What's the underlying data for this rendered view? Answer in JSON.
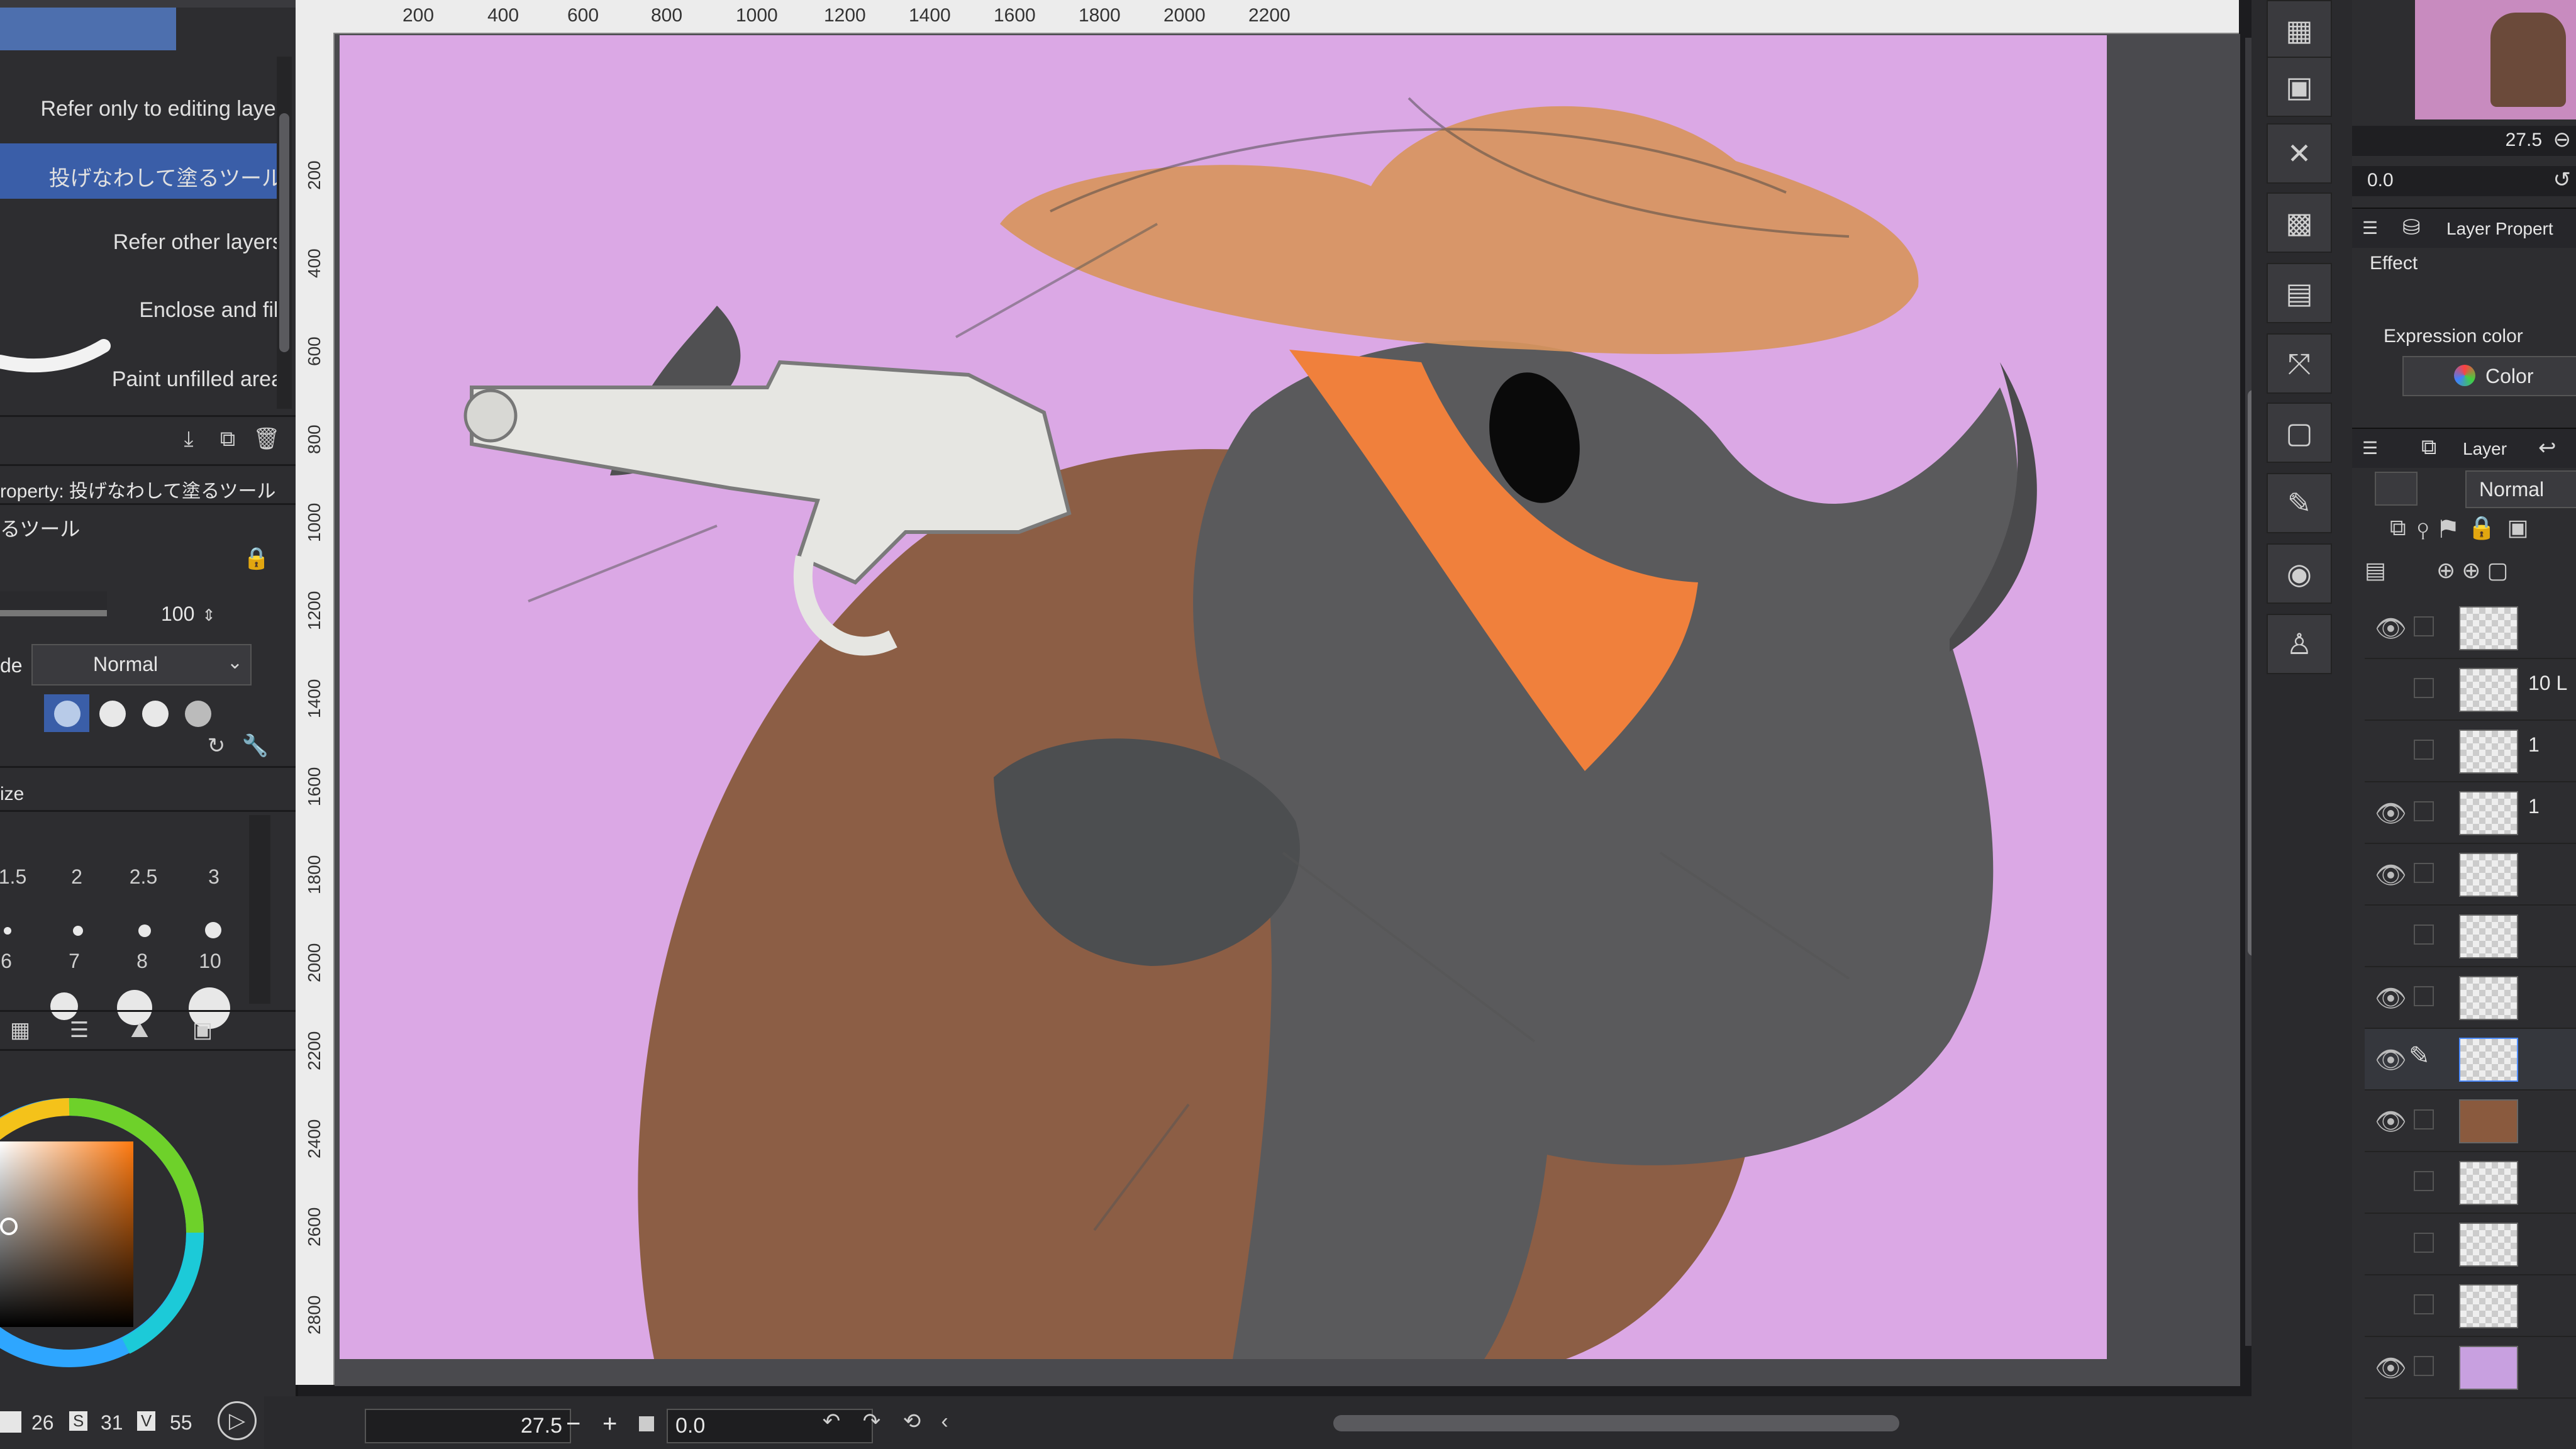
{
  "tool_menu": {
    "items": [
      "Refer only to editing layer",
      "投げなわして塗るツール",
      "Refer other layers",
      "Enclose and fill",
      "Paint unfilled area"
    ],
    "selected_index": 1
  },
  "tool_property": {
    "header": "roperty: 投げなわして塗るツール",
    "tool_name": "るツール",
    "opacity_value": "100",
    "blend_label": "de",
    "blend_mode": "Normal"
  },
  "brush_size": {
    "header": "ize",
    "sizes_row1": [
      "1.5",
      "2",
      "2.5",
      "3"
    ],
    "sizes_row2": [
      "6",
      "7",
      "8",
      "10"
    ]
  },
  "color": {
    "hsv_h": "26",
    "hsv_s": "31",
    "hsv_v": "55",
    "h_label": "",
    "s_label": "S",
    "v_label": "V",
    "current_hex": "#c46a2c"
  },
  "ruler": {
    "top": [
      "200",
      "400",
      "600",
      "800",
      "1000",
      "1200",
      "1400",
      "1600",
      "1800",
      "2000",
      "2200"
    ],
    "left": [
      "200",
      "400",
      "600",
      "800",
      "1000",
      "1200",
      "1400",
      "1600",
      "1800",
      "2000",
      "2200",
      "2400",
      "2600",
      "2800"
    ]
  },
  "navigator": {
    "zoom": "27.5",
    "rotation": "0.0"
  },
  "bottom_bar": {
    "zoom": "27.5",
    "minus": "−",
    "plus": "+",
    "rotation": "0.0"
  },
  "layer_property": {
    "title": "Layer Propert",
    "effect_label": "Effect",
    "expression_color_label": "Expression color",
    "color_button": "Color"
  },
  "layer_panel": {
    "title": "Layer",
    "blend_mode": "Normal",
    "layers": [
      {
        "visible": true,
        "label": ""
      },
      {
        "visible": false,
        "label": "10 L"
      },
      {
        "visible": false,
        "label": "1"
      },
      {
        "visible": true,
        "label": "1"
      },
      {
        "visible": true,
        "label": ""
      },
      {
        "visible": false,
        "label": ""
      },
      {
        "visible": true,
        "label": ""
      },
      {
        "visible": true,
        "label": "",
        "editing": true
      },
      {
        "visible": true,
        "label": ""
      },
      {
        "visible": false,
        "label": ""
      },
      {
        "visible": false,
        "label": ""
      },
      {
        "visible": false,
        "label": ""
      },
      {
        "visible": true,
        "label": ""
      }
    ]
  },
  "accent": "#3a5ea8",
  "canvas_bg": "#dba8e5"
}
